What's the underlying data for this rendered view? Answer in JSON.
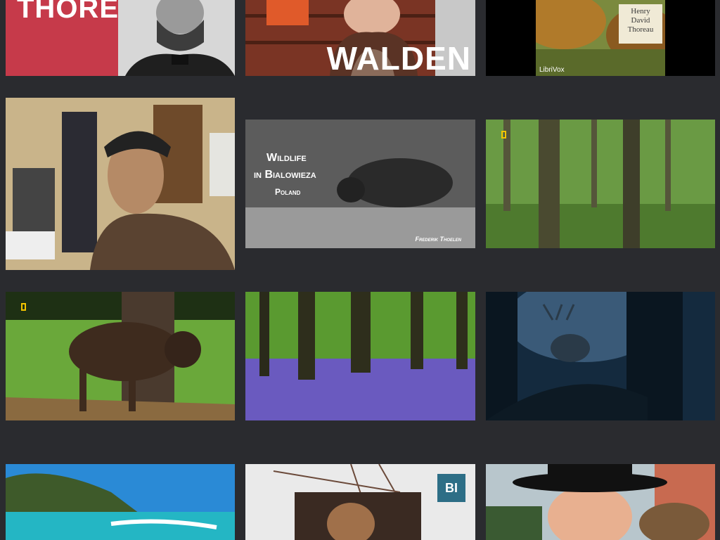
{
  "videos": {
    "thoreau": {
      "title": "THOREAU",
      "brand": "#c63a4a"
    },
    "walden": {
      "title": "WALDEN"
    },
    "librivox": {
      "title_line1": "Henry",
      "title_line2": "David",
      "title_line3": "Thoreau",
      "brand": "LibriVox"
    },
    "vlogger": {},
    "bialowieza": {
      "line1": "Wildlife",
      "line2": "in Bialowieza",
      "line3": "Poland",
      "credit": "Frederik Thoelen"
    },
    "forest": {
      "badge": "national-geographic-icon"
    },
    "bison": {
      "badge": "national-geographic-icon"
    },
    "bluebells": {},
    "stag": {},
    "beach": {},
    "groundhog": {
      "badge": "BI",
      "badge_color": "#2d6e86"
    },
    "groundhog_man": {}
  }
}
